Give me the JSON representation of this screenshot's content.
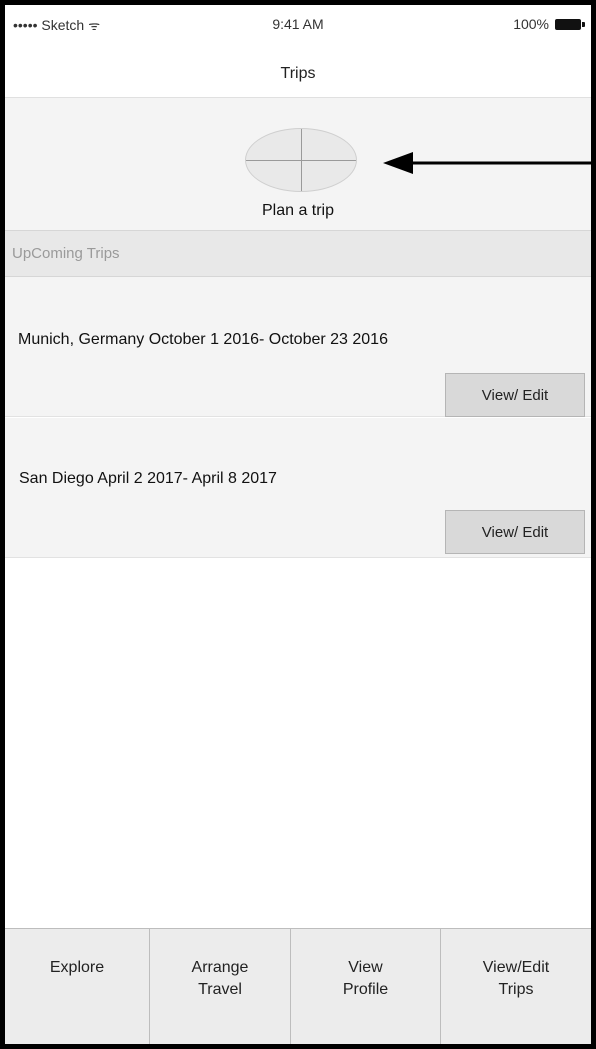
{
  "status_bar": {
    "carrier": "••••• Sketch",
    "wifi_icon": "wifi-icon",
    "time": "9:41 AM",
    "battery_percent": "100%",
    "battery_icon": "battery-icon"
  },
  "nav": {
    "title": "Trips"
  },
  "plan": {
    "image_icon": "image-placeholder-icon",
    "label": "Plan a trip"
  },
  "section": {
    "upcoming_label": "UpComing Trips"
  },
  "trips": [
    {
      "text": "Munich, Germany October 1 2016- October 23 2016",
      "button_label": "View/ Edit"
    },
    {
      "text": "San Diego April 2 2017- April 8 2017",
      "button_label": "View/ Edit"
    }
  ],
  "tabs": [
    {
      "label": "Explore"
    },
    {
      "label": "Arrange\nTravel"
    },
    {
      "label": "View\nProfile"
    },
    {
      "label": "View/Edit\nTrips"
    }
  ]
}
